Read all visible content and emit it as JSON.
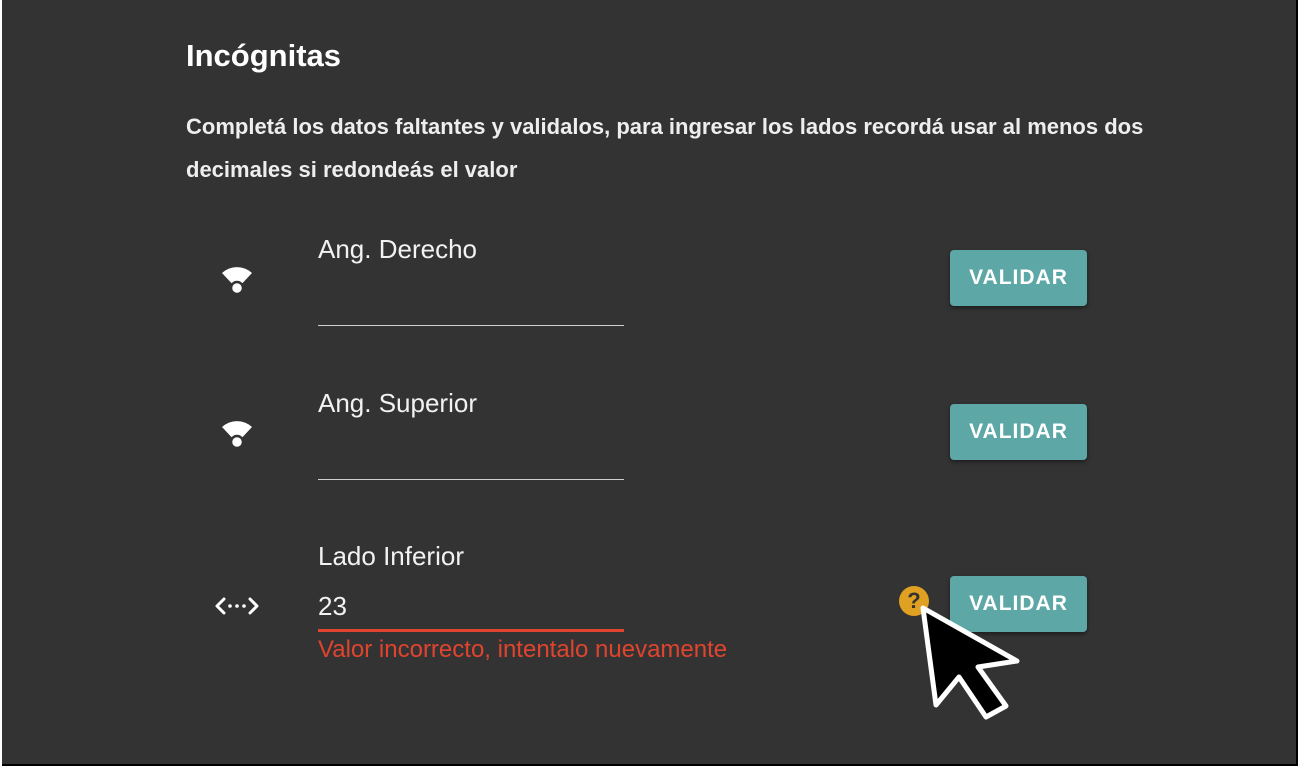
{
  "section": {
    "title": "Incógnitas",
    "description": "Completá los datos faltantes y validalos, para ingresar los lados recordá usar al menos dos decimales si redondeás el valor"
  },
  "rows": [
    {
      "icon": "angle-icon",
      "label": "Ang. Derecho",
      "value": "",
      "button": "VALIDAR"
    },
    {
      "icon": "angle-icon",
      "label": "Ang. Superior",
      "value": "",
      "button": "VALIDAR"
    },
    {
      "icon": "side-length-icon",
      "label": "Lado Inferior",
      "value": "23",
      "error": "Valor incorrecto, intentalo nuevamente",
      "help_icon": "?",
      "button": "VALIDAR"
    }
  ],
  "colors": {
    "background": "#333333",
    "button": "#5ea7a7",
    "error": "#e0442e",
    "help": "#e0a021"
  }
}
